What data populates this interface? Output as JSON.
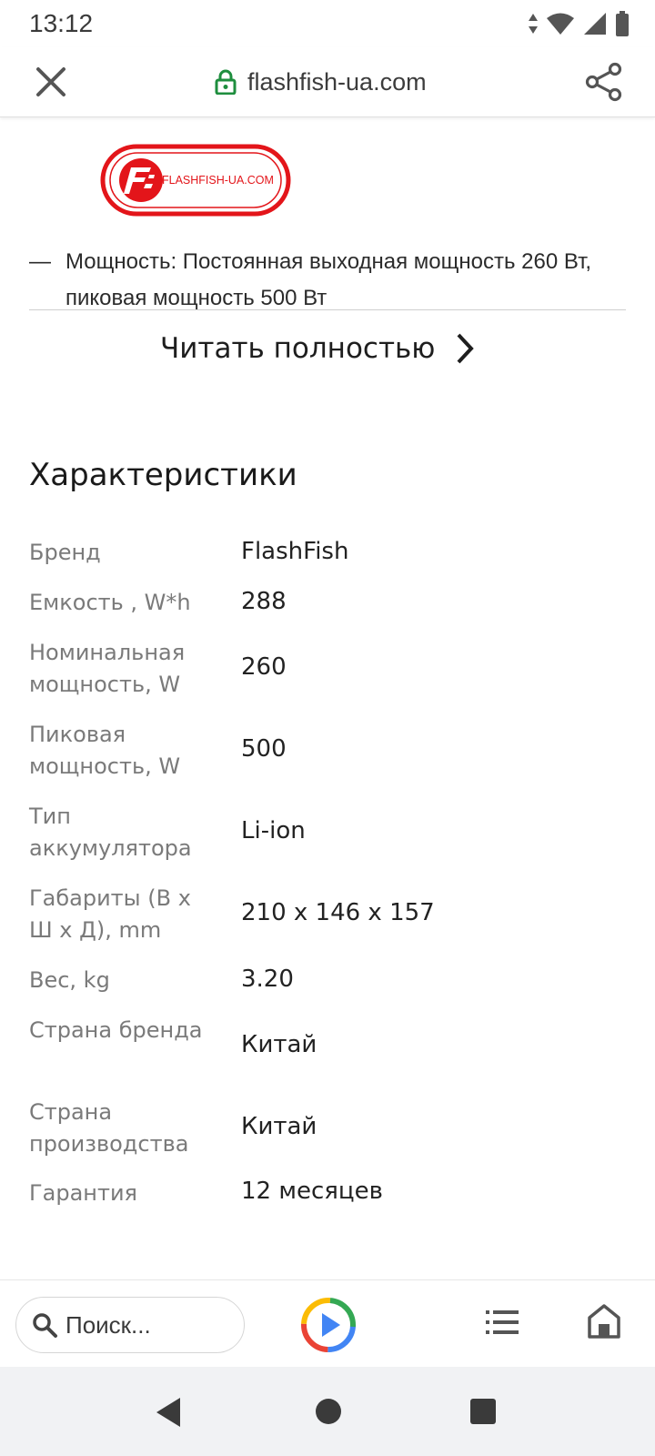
{
  "status": {
    "time": "13:12"
  },
  "browser": {
    "url": "flashfish-ua.com"
  },
  "logo": {
    "text": "FLASHFISH-UA.COM"
  },
  "description": {
    "dash": "—",
    "bullet": "Мощность: Постоянная выходная мощность 260 Вт, пиковая мощность 500 Вт"
  },
  "read_more": {
    "label": "Читать полностью"
  },
  "specs": {
    "title": "Характеристики",
    "rows": [
      {
        "label": "Бренд",
        "value": "FlashFish"
      },
      {
        "label": "Емкость , W*h",
        "value": "288"
      },
      {
        "label": "Номинальная мощность, W",
        "value": "260"
      },
      {
        "label": "Пиковая мощность, W",
        "value": "500"
      },
      {
        "label": "Тип аккумулятора",
        "value": "Li-ion"
      },
      {
        "label": "Габариты (В x Ш x Д), mm",
        "value": "210 x 146 x 157"
      },
      {
        "label": "Вес, kg",
        "value": "3.20"
      },
      {
        "label": "Страна бренда",
        "value": "Китай"
      },
      {
        "label": "Страна производства",
        "value": "Китай"
      },
      {
        "label": "Гарантия",
        "value": "12 месяцев"
      }
    ]
  },
  "bottombar": {
    "search_placeholder": "Поиск..."
  },
  "colors": {
    "logo_red": "#e3151a",
    "lock_green": "#1e8e3e"
  }
}
